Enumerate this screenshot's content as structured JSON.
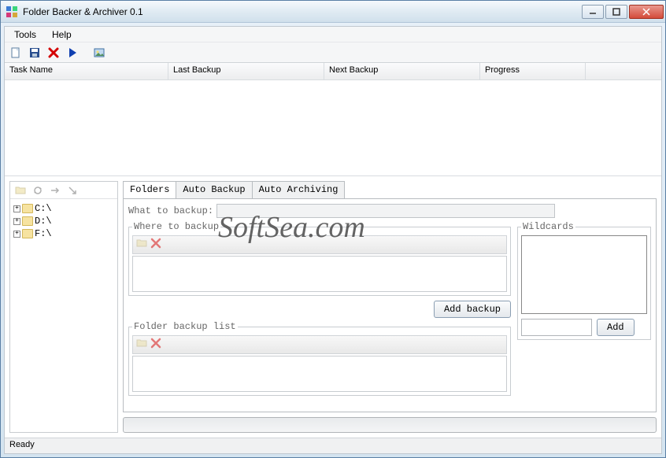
{
  "window": {
    "title": "Folder Backer & Archiver 0.1"
  },
  "menubar": {
    "items": [
      "Tools",
      "Help"
    ]
  },
  "columns": {
    "task_name": "Task Name",
    "last_backup": "Last Backup",
    "next_backup": "Next Backup",
    "progress": "Progress"
  },
  "tree": {
    "drives": [
      "C:\\",
      "D:\\",
      "F:\\"
    ]
  },
  "tabs": {
    "folders": "Folders",
    "auto_backup": "Auto Backup",
    "auto_archiving": "Auto Archiving"
  },
  "form": {
    "what_to_backup_label": "What to backup:",
    "where_to_backup_legend": "Where to backup",
    "add_backup_btn": "Add backup",
    "folder_backup_list_legend": "Folder backup list",
    "wildcards_legend": "Wildcards",
    "add_btn": "Add"
  },
  "statusbar": {
    "text": "Ready"
  },
  "watermark": "SoftSea.com"
}
